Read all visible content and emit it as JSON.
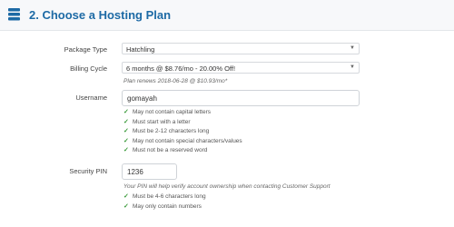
{
  "header": {
    "title": "2. Choose a Hosting Plan",
    "icon": "server-icon",
    "accent": "#1d6aa5"
  },
  "package": {
    "label": "Package Type",
    "selected": "Hatchling"
  },
  "billing": {
    "label": "Billing Cycle",
    "selected": "6 months @ $8.76/mo - 20.00% Off!",
    "renew_note": "Plan renews 2018-06-28 @ $10.93/mo*"
  },
  "username": {
    "label": "Username",
    "value": "gomayah",
    "rules": [
      "May not contain capital letters",
      "Must start with a letter",
      "Must be 2-12 characters long",
      "May not contain special characters/values",
      "Must not be a reserved word"
    ]
  },
  "pin": {
    "label": "Security PIN",
    "value": "1236",
    "note": "Your PIN will help verify account ownership when contacting Customer Support",
    "rules": [
      "Must be 4-6 characters long",
      "May only contain numbers"
    ]
  },
  "colors": {
    "check": "#3a9a3a"
  }
}
